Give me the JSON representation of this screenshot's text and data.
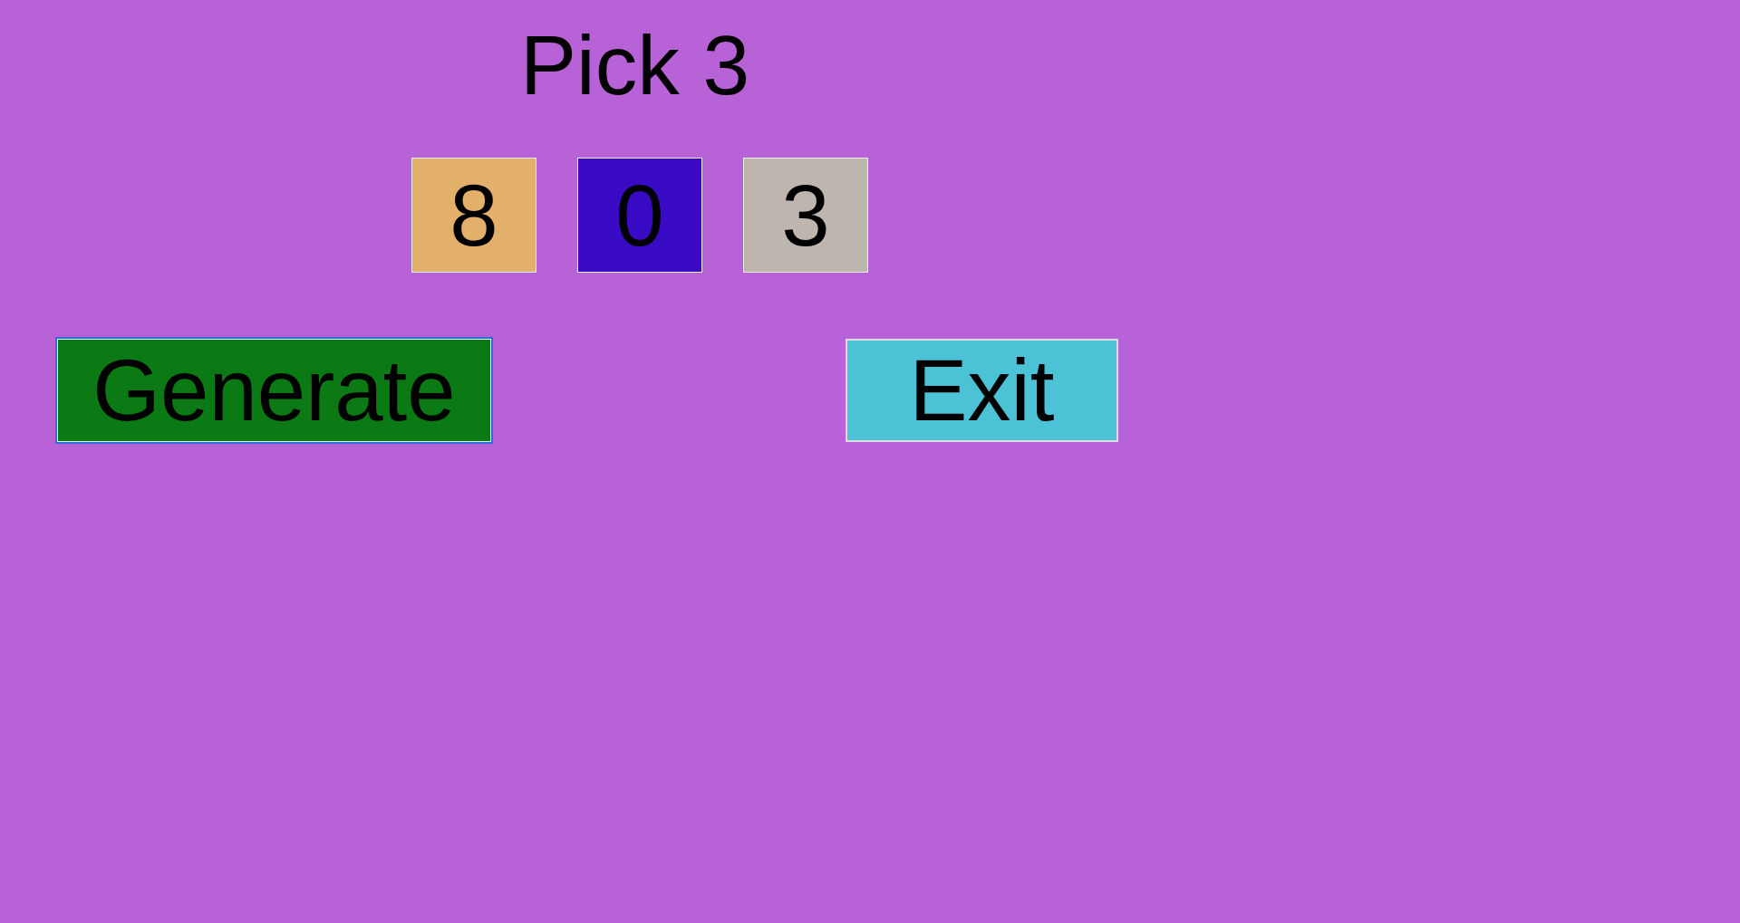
{
  "title": "Pick 3",
  "numbers": [
    {
      "value": "8",
      "color": "#e3b06b"
    },
    {
      "value": "0",
      "color": "#3a0bc5"
    },
    {
      "value": "3",
      "color": "#beb5ae"
    }
  ],
  "buttons": [
    {
      "label": "Generate",
      "color": "#0b7a15",
      "focused": true
    },
    {
      "label": "Exit",
      "color": "#4bc2d6",
      "focused": false
    }
  ]
}
